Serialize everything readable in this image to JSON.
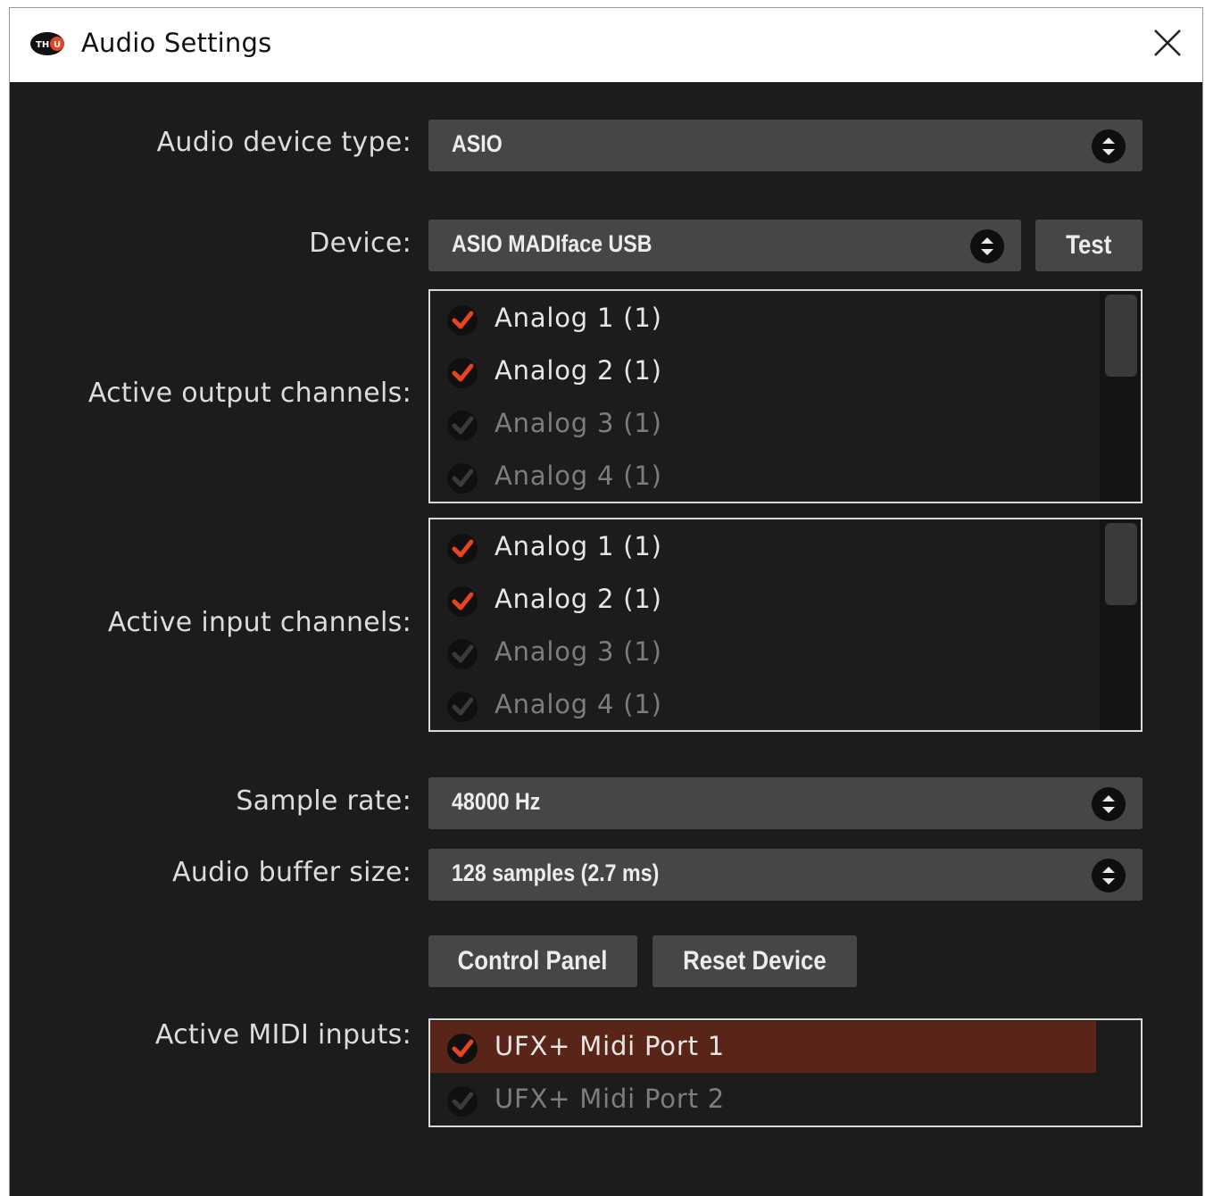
{
  "window": {
    "title": "Audio Settings"
  },
  "labels": {
    "device_type": "Audio device type:",
    "device": "Device:",
    "output_channels": "Active output channels:",
    "input_channels": "Active input channels:",
    "sample_rate": "Sample rate:",
    "buffer_size": "Audio buffer size:",
    "midi_inputs": "Active MIDI inputs:"
  },
  "device_type": {
    "value": "ASIO"
  },
  "device": {
    "value": "ASIO MADIface USB",
    "test_label": "Test"
  },
  "output_channels": {
    "items": [
      {
        "label": "Analog 1 (1)",
        "checked": true
      },
      {
        "label": "Analog 2 (1)",
        "checked": true
      },
      {
        "label": "Analog 3 (1)",
        "checked": false
      },
      {
        "label": "Analog 4 (1)",
        "checked": false
      }
    ]
  },
  "input_channels": {
    "items": [
      {
        "label": "Analog 1 (1)",
        "checked": true
      },
      {
        "label": "Analog 2 (1)",
        "checked": true
      },
      {
        "label": "Analog 3 (1)",
        "checked": false
      },
      {
        "label": "Analog 4 (1)",
        "checked": false
      }
    ]
  },
  "sample_rate": {
    "value": "48000 Hz"
  },
  "buffer_size": {
    "value": "128 samples (2.7 ms)"
  },
  "buttons": {
    "control_panel": "Control Panel",
    "reset_device": "Reset Device"
  },
  "midi_inputs": {
    "items": [
      {
        "label": "UFX+ Midi Port 1",
        "checked": true,
        "selected": true
      },
      {
        "label": "UFX+ Midi Port 2",
        "checked": false,
        "selected": false
      }
    ]
  },
  "colors": {
    "background": "#1c1c1c",
    "control": "#464646",
    "accent": "#e8441f",
    "selected_row": "#5a2519"
  },
  "icons": {
    "app": "th-u-logo-icon",
    "close": "close-icon",
    "combo_arrow": "up-down-arrows-icon",
    "check": "checkmark-icon"
  }
}
